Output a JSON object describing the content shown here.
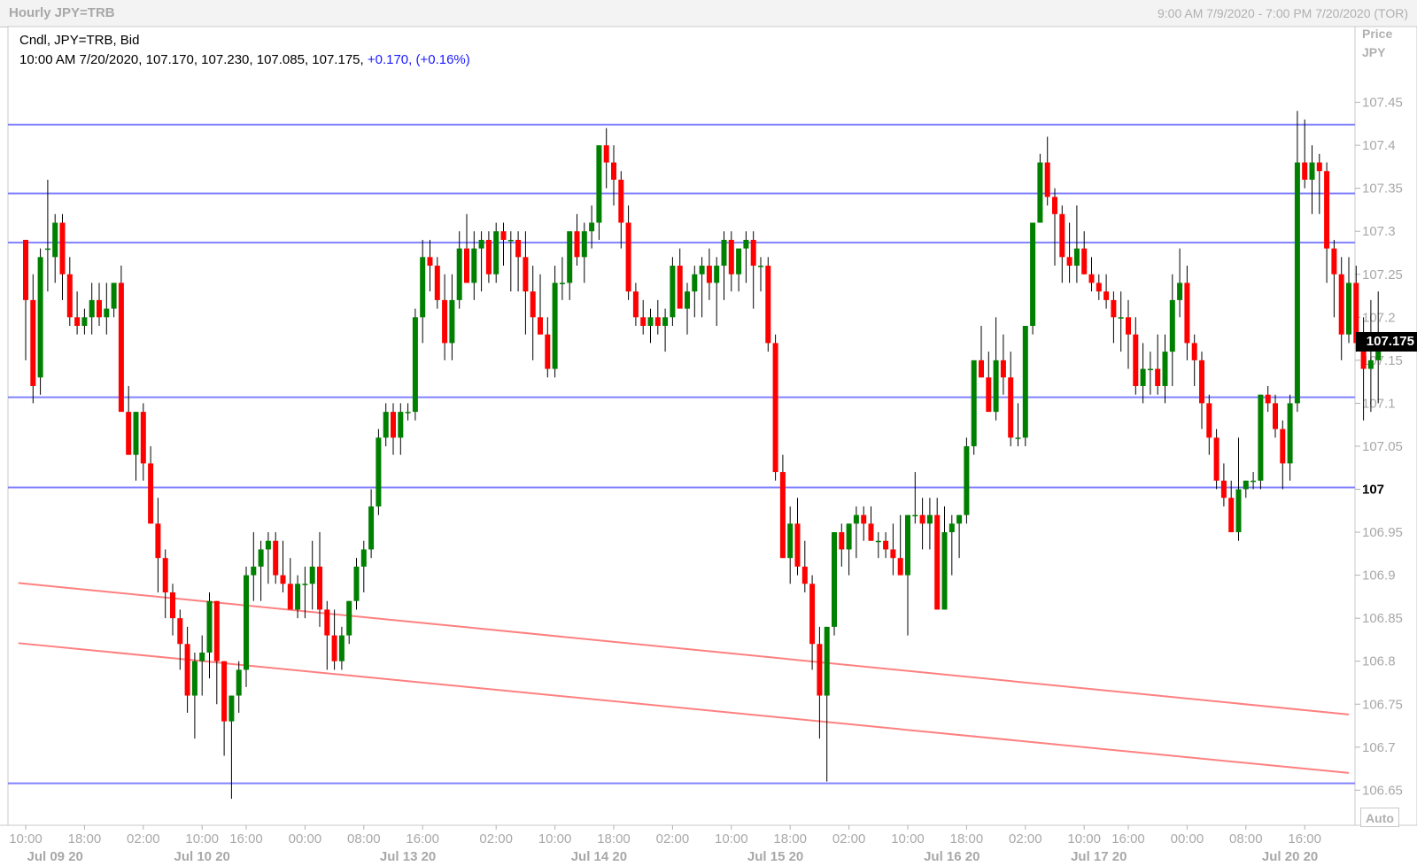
{
  "header": {
    "title": "Hourly JPY=TRB",
    "range": "9:00 AM 7/9/2020 - 7:00 PM 7/20/2020 (TOR)"
  },
  "info": {
    "line1": "Cndl, JPY=TRB, Bid",
    "line2_prefix": "10:00 AM 7/20/2020, 107.170, 107.230, 107.085, 107.175, ",
    "line2_change": "+0.170, (+0.16%)"
  },
  "axis": {
    "header_top": "Price",
    "header_bottom": "JPY",
    "last_price_tag": "107.175",
    "auto_button": "Auto"
  },
  "colors": {
    "up": "#008000",
    "down": "#ff0000",
    "level_line": "#8080ff",
    "channel_line": "#ff8080",
    "grid": "#dcdcdc"
  },
  "chart_data": {
    "type": "candlestick",
    "title": "Hourly JPY=TRB",
    "ylabel": "Price JPY",
    "ylim": [
      106.62,
      107.5
    ],
    "y_ticks": [
      106.65,
      106.7,
      106.75,
      106.8,
      106.85,
      106.9,
      106.95,
      107,
      107.05,
      107.1,
      107.15,
      107.2,
      107.25,
      107.3,
      107.35,
      107.4,
      107.45
    ],
    "y_tick_labels": [
      "106.65",
      "106.7",
      "106.75",
      "106.8",
      "106.85",
      "106.9",
      "106.95",
      "107",
      "107.05",
      "107.1",
      "107.15",
      "107.2",
      "107.25",
      "107.3",
      "107.35",
      "107.4",
      "107.45"
    ],
    "bold_tick": "107",
    "x_time_ticks": [
      {
        "label": "10:00",
        "index": 0
      },
      {
        "label": "18:00",
        "index": 8
      },
      {
        "label": "02:00",
        "index": 16
      },
      {
        "label": "10:00",
        "index": 24
      },
      {
        "label": "16:00",
        "index": 30
      },
      {
        "label": "00:00",
        "index": 38
      },
      {
        "label": "08:00",
        "index": 46
      },
      {
        "label": "16:00",
        "index": 54
      },
      {
        "label": "02:00",
        "index": 64
      },
      {
        "label": "10:00",
        "index": 72
      },
      {
        "label": "18:00",
        "index": 80
      },
      {
        "label": "02:00",
        "index": 88
      },
      {
        "label": "10:00",
        "index": 96
      },
      {
        "label": "18:00",
        "index": 104
      },
      {
        "label": "02:00",
        "index": 112
      },
      {
        "label": "10:00",
        "index": 120
      },
      {
        "label": "18:00",
        "index": 128
      },
      {
        "label": "02:00",
        "index": 136
      },
      {
        "label": "10:00",
        "index": 144
      },
      {
        "label": "16:00",
        "index": 150
      },
      {
        "label": "00:00",
        "index": 158
      },
      {
        "label": "08:00",
        "index": 166
      },
      {
        "label": "16:00",
        "index": 174
      }
    ],
    "x_date_labels": [
      {
        "label": "Jul 09 20",
        "index": 4
      },
      {
        "label": "Jul 10 20",
        "index": 24
      },
      {
        "label": "Jul 13 20",
        "index": 52
      },
      {
        "label": "Jul 14 20",
        "index": 78
      },
      {
        "label": "Jul 15 20",
        "index": 102
      },
      {
        "label": "Jul 16 20",
        "index": 126
      },
      {
        "label": "Jul 17 20",
        "index": 146
      },
      {
        "label": "Jul 20 20",
        "index": 172
      }
    ],
    "horizontal_levels": [
      107.424,
      107.344,
      107.287,
      107.107,
      107.002,
      106.658
    ],
    "channel_lines": [
      {
        "from": {
          "index": -1,
          "y": 106.891
        },
        "to": {
          "index": 180,
          "y": 106.738
        }
      },
      {
        "from": {
          "index": -1,
          "y": 106.821
        },
        "to": {
          "index": 180,
          "y": 106.67
        }
      }
    ],
    "ohlc": [
      [
        107.29,
        107.29,
        107.15,
        107.22
      ],
      [
        107.22,
        107.25,
        107.1,
        107.12
      ],
      [
        107.13,
        107.28,
        107.11,
        107.27
      ],
      [
        107.28,
        107.36,
        107.23,
        107.28
      ],
      [
        107.27,
        107.32,
        107.24,
        107.31
      ],
      [
        107.31,
        107.32,
        107.22,
        107.25
      ],
      [
        107.25,
        107.27,
        107.19,
        107.2
      ],
      [
        107.2,
        107.23,
        107.18,
        107.19
      ],
      [
        107.19,
        107.21,
        107.18,
        107.2
      ],
      [
        107.2,
        107.24,
        107.18,
        107.22
      ],
      [
        107.22,
        107.24,
        107.19,
        107.2
      ],
      [
        107.2,
        107.24,
        107.18,
        107.21
      ],
      [
        107.21,
        107.24,
        107.2,
        107.24
      ],
      [
        107.24,
        107.26,
        107.1,
        107.09
      ],
      [
        107.09,
        107.12,
        107.04,
        107.04
      ],
      [
        107.04,
        107.09,
        107.01,
        107.09
      ],
      [
        107.09,
        107.1,
        107.01,
        107.03
      ],
      [
        107.03,
        107.05,
        106.96,
        106.96
      ],
      [
        106.96,
        106.99,
        106.88,
        106.92
      ],
      [
        106.92,
        106.93,
        106.85,
        106.88
      ],
      [
        106.88,
        106.89,
        106.83,
        106.85
      ],
      [
        106.85,
        106.86,
        106.79,
        106.82
      ],
      [
        106.82,
        106.84,
        106.74,
        106.76
      ],
      [
        106.76,
        106.81,
        106.71,
        106.8
      ],
      [
        106.8,
        106.83,
        106.76,
        106.81
      ],
      [
        106.81,
        106.88,
        106.78,
        106.87
      ],
      [
        106.87,
        106.87,
        106.75,
        106.8
      ],
      [
        106.8,
        106.8,
        106.69,
        106.73
      ],
      [
        106.73,
        106.76,
        106.64,
        106.76
      ],
      [
        106.76,
        106.8,
        106.74,
        106.79
      ],
      [
        106.79,
        106.91,
        106.77,
        106.9
      ],
      [
        106.9,
        106.95,
        106.87,
        106.91
      ],
      [
        106.91,
        106.94,
        106.87,
        106.93
      ],
      [
        106.93,
        106.95,
        106.89,
        106.94
      ],
      [
        106.94,
        106.95,
        106.89,
        106.9
      ],
      [
        106.9,
        106.94,
        106.88,
        106.89
      ],
      [
        106.89,
        106.92,
        106.86,
        106.86
      ],
      [
        106.86,
        106.9,
        106.85,
        106.89
      ],
      [
        106.89,
        106.91,
        106.85,
        106.89
      ],
      [
        106.89,
        106.94,
        106.86,
        106.91
      ],
      [
        106.91,
        106.95,
        106.84,
        106.86
      ],
      [
        106.86,
        106.87,
        106.79,
        106.83
      ],
      [
        106.83,
        106.86,
        106.79,
        106.8
      ],
      [
        106.8,
        106.84,
        106.79,
        106.83
      ],
      [
        106.83,
        106.87,
        106.82,
        106.87
      ],
      [
        106.87,
        106.92,
        106.86,
        106.91
      ],
      [
        106.91,
        106.94,
        106.88,
        106.93
      ],
      [
        106.93,
        107.0,
        106.92,
        106.98
      ],
      [
        106.98,
        107.07,
        106.97,
        107.06
      ],
      [
        107.06,
        107.1,
        107.05,
        107.09
      ],
      [
        107.09,
        107.1,
        107.04,
        107.06
      ],
      [
        107.06,
        107.1,
        107.04,
        107.09
      ],
      [
        107.09,
        107.1,
        107.08,
        107.09
      ],
      [
        107.09,
        107.21,
        107.08,
        107.2
      ],
      [
        107.2,
        107.29,
        107.17,
        107.27
      ],
      [
        107.27,
        107.29,
        107.23,
        107.26
      ],
      [
        107.26,
        107.27,
        107.21,
        107.22
      ],
      [
        107.22,
        107.25,
        107.15,
        107.17
      ],
      [
        107.17,
        107.25,
        107.15,
        107.22
      ],
      [
        107.22,
        107.3,
        107.21,
        107.28
      ],
      [
        107.28,
        107.32,
        107.24,
        107.24
      ],
      [
        107.24,
        107.3,
        107.22,
        107.28
      ],
      [
        107.28,
        107.3,
        107.23,
        107.29
      ],
      [
        107.29,
        107.3,
        107.24,
        107.25
      ],
      [
        107.25,
        107.31,
        107.24,
        107.3
      ],
      [
        107.3,
        107.31,
        107.26,
        107.29
      ],
      [
        107.29,
        107.3,
        107.23,
        107.29
      ],
      [
        107.29,
        107.3,
        107.23,
        107.27
      ],
      [
        107.27,
        107.3,
        107.18,
        107.23
      ],
      [
        107.23,
        107.26,
        107.15,
        107.2
      ],
      [
        107.2,
        107.25,
        107.18,
        107.18
      ],
      [
        107.18,
        107.2,
        107.13,
        107.14
      ],
      [
        107.14,
        107.26,
        107.13,
        107.24
      ],
      [
        107.24,
        107.27,
        107.22,
        107.24
      ],
      [
        107.24,
        107.3,
        107.22,
        107.3
      ],
      [
        107.3,
        107.32,
        107.26,
        107.27
      ],
      [
        107.27,
        107.31,
        107.24,
        107.3
      ],
      [
        107.3,
        107.33,
        107.28,
        107.31
      ],
      [
        107.31,
        107.4,
        107.29,
        107.4
      ],
      [
        107.4,
        107.42,
        107.35,
        107.38
      ],
      [
        107.38,
        107.4,
        107.33,
        107.36
      ],
      [
        107.36,
        107.37,
        107.28,
        107.31
      ],
      [
        107.31,
        107.33,
        107.22,
        107.23
      ],
      [
        107.23,
        107.24,
        107.19,
        107.2
      ],
      [
        107.2,
        107.22,
        107.18,
        107.19
      ],
      [
        107.19,
        107.21,
        107.17,
        107.2
      ],
      [
        107.2,
        107.22,
        107.18,
        107.19
      ],
      [
        107.19,
        107.21,
        107.16,
        107.2
      ],
      [
        107.2,
        107.27,
        107.19,
        107.26
      ],
      [
        107.26,
        107.28,
        107.21,
        107.21
      ],
      [
        107.21,
        107.24,
        107.18,
        107.23
      ],
      [
        107.23,
        107.26,
        107.2,
        107.25
      ],
      [
        107.25,
        107.27,
        107.2,
        107.26
      ],
      [
        107.26,
        107.28,
        107.22,
        107.24
      ],
      [
        107.24,
        107.27,
        107.19,
        107.26
      ],
      [
        107.26,
        107.3,
        107.22,
        107.29
      ],
      [
        107.29,
        107.3,
        107.23,
        107.25
      ],
      [
        107.25,
        107.28,
        107.23,
        107.28
      ],
      [
        107.28,
        107.3,
        107.24,
        107.29
      ],
      [
        107.29,
        107.3,
        107.21,
        107.26
      ],
      [
        107.26,
        107.27,
        107.23,
        107.26
      ],
      [
        107.26,
        107.27,
        107.16,
        107.17
      ],
      [
        107.17,
        107.18,
        107.01,
        107.02
      ],
      [
        107.02,
        107.04,
        106.92,
        106.92
      ],
      [
        106.92,
        106.98,
        106.89,
        106.96
      ],
      [
        106.96,
        106.99,
        106.9,
        106.91
      ],
      [
        106.91,
        106.94,
        106.88,
        106.89
      ],
      [
        106.89,
        106.9,
        106.79,
        106.82
      ],
      [
        106.82,
        106.84,
        106.71,
        106.76
      ],
      [
        106.76,
        106.84,
        106.66,
        106.84
      ],
      [
        106.84,
        106.95,
        106.83,
        106.95
      ],
      [
        106.95,
        106.96,
        106.91,
        106.93
      ],
      [
        106.93,
        106.96,
        106.9,
        106.96
      ],
      [
        106.96,
        106.98,
        106.92,
        106.97
      ],
      [
        106.97,
        106.98,
        106.94,
        106.96
      ],
      [
        106.96,
        106.98,
        106.94,
        106.94
      ],
      [
        106.94,
        106.95,
        106.92,
        106.94
      ],
      [
        106.94,
        106.95,
        106.92,
        106.93
      ],
      [
        106.93,
        106.96,
        106.9,
        106.92
      ],
      [
        106.92,
        106.97,
        106.9,
        106.9
      ],
      [
        106.9,
        106.96,
        106.83,
        106.97
      ],
      [
        106.97,
        107.02,
        106.96,
        106.97
      ],
      [
        106.97,
        106.99,
        106.93,
        106.96
      ],
      [
        106.96,
        106.99,
        106.93,
        106.97
      ],
      [
        106.97,
        106.99,
        106.86,
        106.86
      ],
      [
        106.86,
        106.98,
        106.86,
        106.95
      ],
      [
        106.95,
        106.97,
        106.9,
        106.96
      ],
      [
        106.96,
        106.97,
        106.92,
        106.97
      ],
      [
        106.97,
        107.06,
        106.96,
        107.05
      ],
      [
        107.05,
        107.15,
        107.04,
        107.15
      ],
      [
        107.15,
        107.19,
        107.13,
        107.13
      ],
      [
        107.13,
        107.16,
        107.09,
        107.09
      ],
      [
        107.09,
        107.2,
        107.08,
        107.15
      ],
      [
        107.15,
        107.18,
        107.11,
        107.13
      ],
      [
        107.13,
        107.16,
        107.05,
        107.06
      ],
      [
        107.06,
        107.1,
        107.05,
        107.06
      ],
      [
        107.06,
        107.19,
        107.05,
        107.19
      ],
      [
        107.19,
        107.31,
        107.18,
        107.31
      ],
      [
        107.31,
        107.39,
        107.31,
        107.38
      ],
      [
        107.38,
        107.41,
        107.33,
        107.34
      ],
      [
        107.34,
        107.35,
        107.26,
        107.32
      ],
      [
        107.32,
        107.33,
        107.24,
        107.27
      ],
      [
        107.27,
        107.31,
        107.24,
        107.26
      ],
      [
        107.26,
        107.33,
        107.24,
        107.28
      ],
      [
        107.28,
        107.3,
        107.25,
        107.25
      ],
      [
        107.25,
        107.27,
        107.23,
        107.24
      ],
      [
        107.24,
        107.25,
        107.22,
        107.23
      ],
      [
        107.23,
        107.25,
        107.21,
        107.22
      ],
      [
        107.22,
        107.23,
        107.17,
        107.2
      ],
      [
        107.2,
        107.23,
        107.16,
        107.2
      ],
      [
        107.2,
        107.22,
        107.14,
        107.18
      ],
      [
        107.18,
        107.2,
        107.11,
        107.12
      ],
      [
        107.12,
        107.17,
        107.1,
        107.14
      ],
      [
        107.14,
        107.16,
        107.11,
        107.14
      ],
      [
        107.14,
        107.18,
        107.11,
        107.12
      ],
      [
        107.12,
        107.18,
        107.1,
        107.16
      ],
      [
        107.16,
        107.25,
        107.12,
        107.22
      ],
      [
        107.22,
        107.28,
        107.2,
        107.24
      ],
      [
        107.24,
        107.26,
        107.15,
        107.17
      ],
      [
        107.17,
        107.18,
        107.12,
        107.15
      ],
      [
        107.15,
        107.16,
        107.07,
        107.1
      ],
      [
        107.1,
        107.11,
        107.04,
        107.06
      ],
      [
        107.06,
        107.07,
        107.0,
        107.01
      ],
      [
        107.01,
        107.03,
        106.98,
        106.99
      ],
      [
        106.99,
        107.01,
        106.95,
        106.95
      ],
      [
        106.95,
        107.06,
        106.94,
        107.0
      ],
      [
        107.0,
        107.01,
        106.99,
        107.01
      ],
      [
        107.01,
        107.02,
        107.0,
        107.01
      ],
      [
        107.01,
        107.11,
        107.0,
        107.11
      ],
      [
        107.11,
        107.12,
        107.09,
        107.1
      ],
      [
        107.1,
        107.11,
        107.06,
        107.07
      ],
      [
        107.07,
        107.08,
        107.0,
        107.03
      ],
      [
        107.03,
        107.11,
        107.01,
        107.1
      ],
      [
        107.1,
        107.44,
        107.09,
        107.38
      ],
      [
        107.38,
        107.43,
        107.35,
        107.36
      ],
      [
        107.36,
        107.4,
        107.32,
        107.38
      ],
      [
        107.38,
        107.39,
        107.32,
        107.37
      ],
      [
        107.37,
        107.38,
        107.24,
        107.28
      ],
      [
        107.28,
        107.29,
        107.2,
        107.25
      ],
      [
        107.25,
        107.27,
        107.15,
        107.18
      ],
      [
        107.18,
        107.27,
        107.17,
        107.24
      ],
      [
        107.24,
        107.26,
        107.16,
        107.17
      ],
      [
        107.17,
        107.2,
        107.08,
        107.14
      ],
      [
        107.14,
        107.22,
        107.09,
        107.15
      ],
      [
        107.15,
        107.23,
        107.1,
        107.175
      ]
    ]
  }
}
